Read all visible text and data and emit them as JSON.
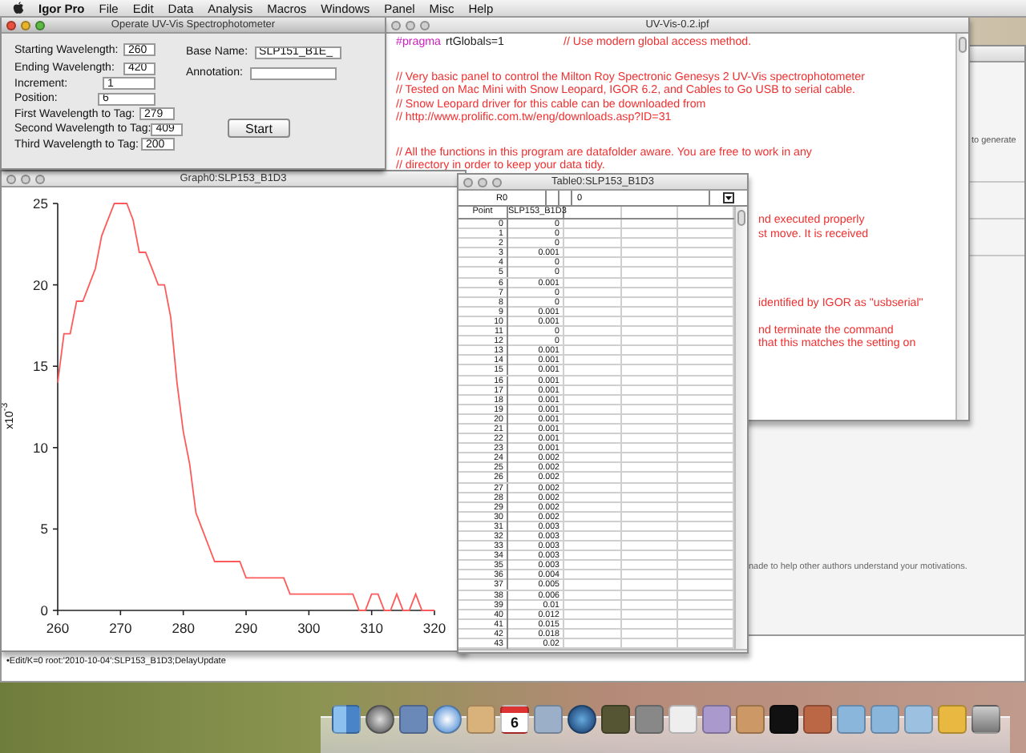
{
  "menu_bar": {
    "items": [
      {
        "label": "Igor Pro",
        "kind": "app"
      },
      {
        "label": "File",
        "kind": "menu"
      },
      {
        "label": "Edit",
        "kind": "menu"
      },
      {
        "label": "Data",
        "kind": "menu"
      },
      {
        "label": "Analysis",
        "kind": "menu"
      },
      {
        "label": "Macros",
        "kind": "menu"
      },
      {
        "label": "Windows",
        "kind": "menu"
      },
      {
        "label": "Panel",
        "kind": "menu"
      },
      {
        "label": "Misc",
        "kind": "menu"
      },
      {
        "label": "Help",
        "kind": "menu"
      }
    ]
  },
  "back_window": {
    "active": false,
    "texts": [
      "to generate",
      "nade to help other authors understand your motivations."
    ]
  },
  "procedure_window": {
    "title": "UV-Vis-0.2.ipf",
    "active": false,
    "pragma": {
      "keyword": "#pragma",
      "code": "rtGlobals=1",
      "comment": "// Use modern global access method."
    },
    "paragraphs": [
      [
        "// Very basic panel to control the Milton Roy Spectronic Genesys 2 UV-Vis spectrophotometer",
        "// Tested on Mac Mini with Snow Leopard, IGOR 6.2, and Cables to Go USB to serial cable.",
        "// Snow Leopard driver for this cable can be downloaded from",
        "// http://www.prolific.com.tw/eng/downloads.asp?ID=31"
      ],
      [
        "// All the functions in this program are datafolder aware. You are free to work in any",
        "// directory in order to keep your data tidy."
      ]
    ],
    "fragments": [
      [
        "nd executed properly",
        "st move. It is received"
      ],
      [
        "identified by IGOR as \"usbserial\""
      ],
      [
        "nd terminate the command",
        "that this matches the setting on"
      ]
    ]
  },
  "panel_window": {
    "title": "Operate UV-Vis Spectrophotometer",
    "active": true,
    "left_fields": [
      {
        "label": "Starting Wavelength:",
        "value": "260"
      },
      {
        "label": "Ending Wavelength:",
        "value": "420"
      },
      {
        "label": "Increment:",
        "value": "1"
      },
      {
        "label": "Position:",
        "value": "6"
      },
      {
        "label": "First Wavelength to Tag:",
        "value": "279"
      },
      {
        "label": "Second Wavelength to Tag:",
        "value": "409"
      },
      {
        "label": "Third Wavelength to Tag:",
        "value": "200"
      }
    ],
    "right_fields": [
      {
        "label": "Base Name:",
        "value": "SLP151_B1E_"
      },
      {
        "label": "Annotation:"
      }
    ],
    "button": "Start"
  },
  "graph_window": {
    "title": "Graph0:SLP153_B1D3",
    "active": false,
    "chart_data": {
      "type": "line",
      "ylabel": "x10$^{-3}$",
      "x": [
        260,
        261,
        262,
        263,
        264,
        265,
        266,
        267,
        268,
        269,
        270,
        271,
        272,
        273,
        274,
        275,
        276,
        277,
        278,
        279,
        280,
        281,
        282,
        283,
        284,
        285,
        286,
        287,
        288,
        289,
        290,
        291,
        292,
        293,
        294,
        295,
        296,
        297,
        298,
        299,
        300,
        301,
        302,
        303,
        304,
        305,
        306,
        307,
        308,
        309,
        310,
        311,
        312,
        313,
        314,
        315,
        316,
        317,
        318,
        319,
        320
      ],
      "series": [
        {
          "color": "#ff5a5a",
          "values": [
            14,
            17,
            17,
            19,
            19,
            20,
            21,
            23,
            24,
            25,
            25,
            25,
            24,
            22,
            22,
            21,
            20,
            20,
            18,
            14,
            11,
            9,
            6,
            5,
            4,
            3,
            3,
            3,
            3,
            3,
            2,
            2,
            2,
            2,
            2,
            2,
            2,
            1,
            1,
            1,
            1,
            1,
            1,
            1,
            1,
            1,
            1,
            1,
            0,
            0,
            1,
            1,
            0,
            0,
            1,
            0,
            0,
            1,
            0,
            0,
            0
          ]
        }
      ],
      "xlim": [
        260,
        320
      ],
      "ylim": [
        0,
        25
      ],
      "xticks": [
        260,
        270,
        280,
        290,
        300,
        310,
        320
      ],
      "yticks": [
        0,
        5,
        10,
        15,
        20,
        25
      ]
    }
  },
  "table_window": {
    "title": "Table0:SLP153_B1D3",
    "active": false,
    "entry_cell": "R0",
    "entry_value": "0",
    "columns": [
      "Point",
      "SLP153_B1D3"
    ],
    "rows": [
      [
        "0",
        "0"
      ],
      [
        "1",
        "0"
      ],
      [
        "2",
        "0"
      ],
      [
        "3",
        "0.001"
      ],
      [
        "4",
        "0"
      ],
      [
        "5",
        "0"
      ],
      [
        "6",
        "0.001"
      ],
      [
        "7",
        "0"
      ],
      [
        "8",
        "0"
      ],
      [
        "9",
        "0.001"
      ],
      [
        "10",
        "0.001"
      ],
      [
        "11",
        "0"
      ],
      [
        "12",
        "0"
      ],
      [
        "13",
        "0.001"
      ],
      [
        "14",
        "0.001"
      ],
      [
        "15",
        "0.001"
      ],
      [
        "16",
        "0.001"
      ],
      [
        "17",
        "0.001"
      ],
      [
        "18",
        "0.001"
      ],
      [
        "19",
        "0.001"
      ],
      [
        "20",
        "0.001"
      ],
      [
        "21",
        "0.001"
      ],
      [
        "22",
        "0.001"
      ],
      [
        "23",
        "0.001"
      ],
      [
        "24",
        "0.002"
      ],
      [
        "25",
        "0.002"
      ],
      [
        "26",
        "0.002"
      ],
      [
        "27",
        "0.002"
      ],
      [
        "28",
        "0.002"
      ],
      [
        "29",
        "0.002"
      ],
      [
        "30",
        "0.002"
      ],
      [
        "31",
        "0.003"
      ],
      [
        "32",
        "0.003"
      ],
      [
        "33",
        "0.003"
      ],
      [
        "34",
        "0.003"
      ],
      [
        "35",
        "0.003"
      ],
      [
        "36",
        "0.004"
      ],
      [
        "37",
        "0.005"
      ],
      [
        "38",
        "0.006"
      ],
      [
        "39",
        "0.01"
      ],
      [
        "40",
        "0.012"
      ],
      [
        "41",
        "0.015"
      ],
      [
        "42",
        "0.018"
      ],
      [
        "43",
        "0.02"
      ]
    ]
  },
  "command_window": {
    "line": "•Edit/K=0 root:'2010-10-04':SLP153_B1D3;DelayUpdate"
  },
  "dock": {
    "calendar_day": "6"
  }
}
